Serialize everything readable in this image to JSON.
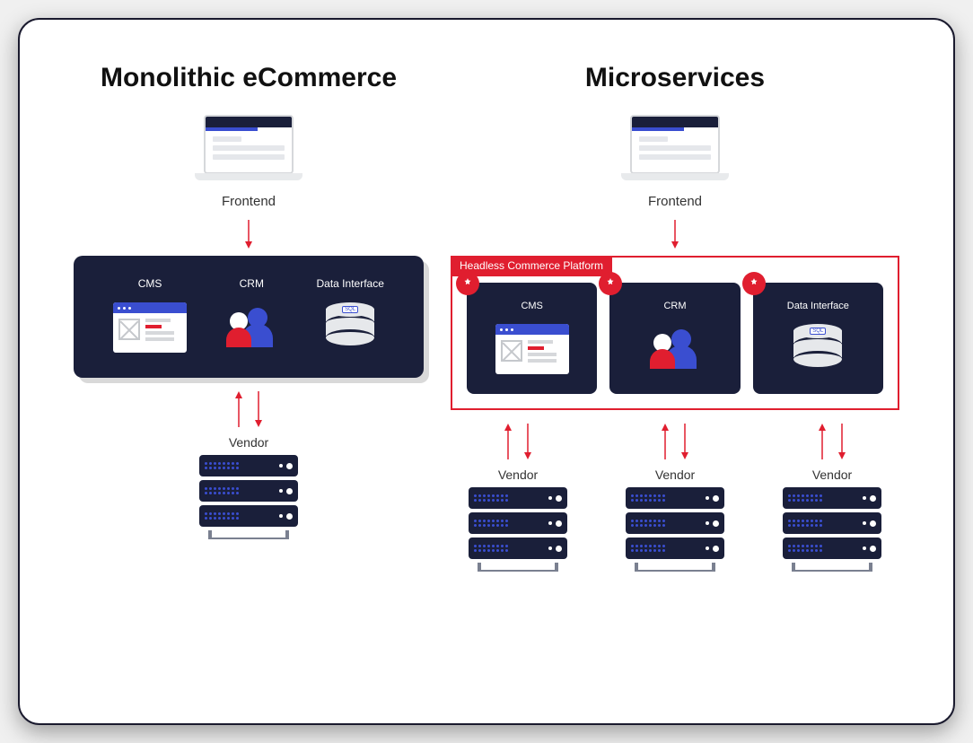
{
  "left": {
    "heading": "Monolithic eCommerce",
    "frontend_label": "Frontend",
    "block": {
      "cms": "CMS",
      "crm": "CRM",
      "data": "Data Interface"
    },
    "vendor_label": "Vendor"
  },
  "right": {
    "heading": "Microservices",
    "frontend_label": "Frontend",
    "platform_label": "Headless Commerce Platform",
    "cards": {
      "cms": "CMS",
      "crm": "CRM",
      "data": "Data Interface"
    },
    "vendor_label": "Vendor"
  },
  "icons": {
    "db_tag": "SQL"
  }
}
